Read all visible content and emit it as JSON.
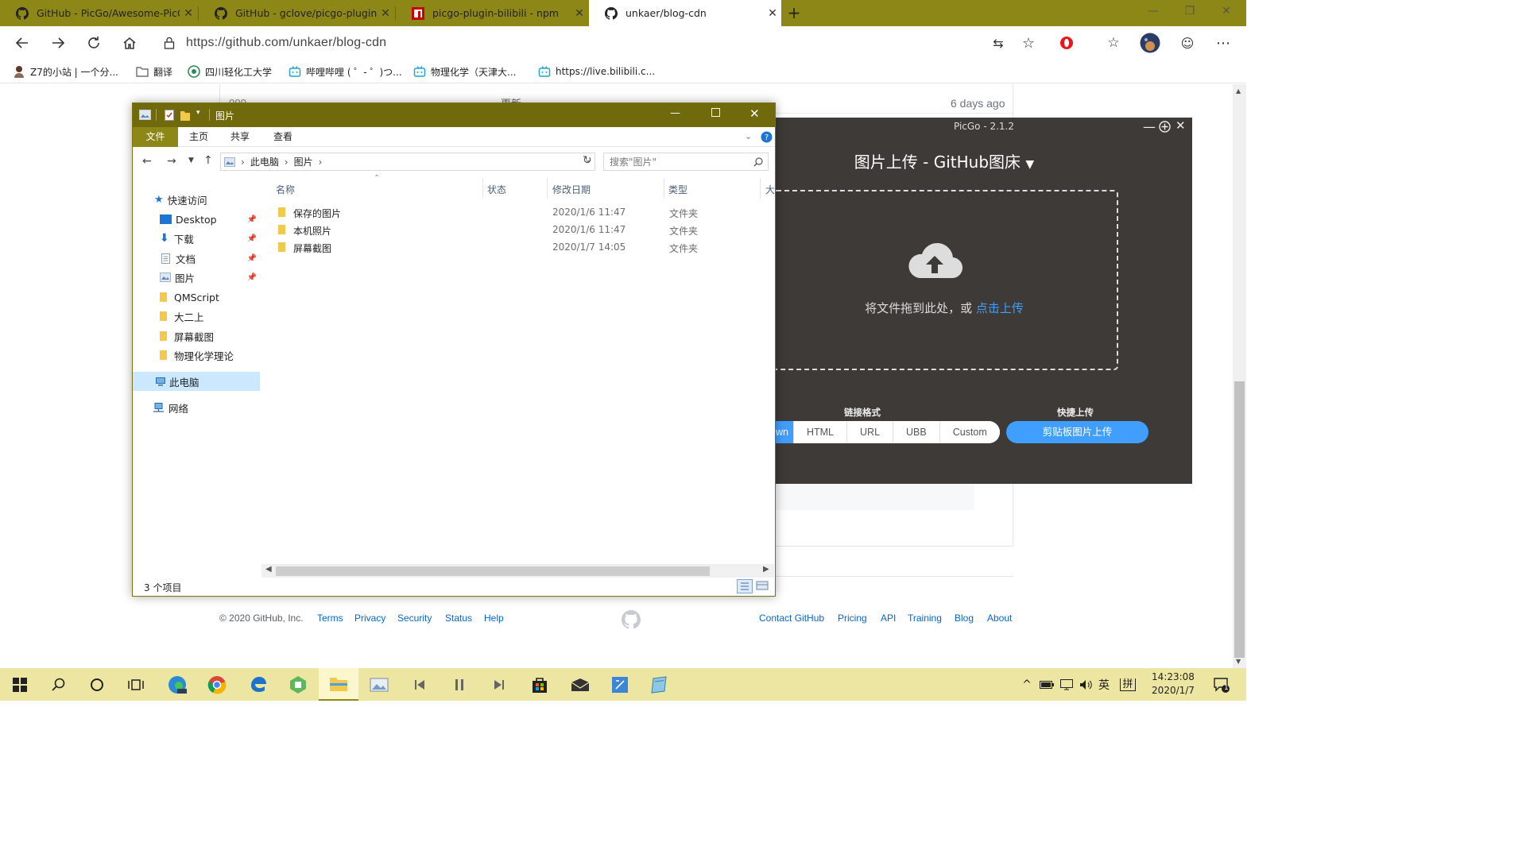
{
  "browser": {
    "tabs": [
      {
        "title": "GitHub - PicGo/Awesome-PicGo",
        "icon": "github-icon"
      },
      {
        "title": "GitHub - gclove/picgo-plugin-su",
        "icon": "github-icon"
      },
      {
        "title": "picgo-plugin-bilibili - npm",
        "icon": "npm-icon"
      },
      {
        "title": "unkaer/blog-cdn",
        "icon": "github-icon"
      }
    ],
    "close_glyph": "✕",
    "new_tab_glyph": "+",
    "url": "https://github.com/unkaer/blog-cdn",
    "favorites": [
      {
        "label": "Z7的小站 | 一个分...",
        "icon": "avatar-icon"
      },
      {
        "label": "翻译",
        "icon": "folder-icon"
      },
      {
        "label": "四川轻化工大学",
        "icon": "globe-icon"
      },
      {
        "label": "哔哩哔哩 ( ゜- ゜)つ...",
        "icon": "bilibili-icon"
      },
      {
        "label": "物理化学（天津大...",
        "icon": "bilibili-icon"
      },
      {
        "label": "https://live.bilibili.c...",
        "icon": "bilibili-icon"
      }
    ]
  },
  "github": {
    "row_time": "6 days ago",
    "row_partial_a": "ooo",
    "row_partial_b": "更新",
    "copyright": "© 2020 GitHub, Inc.",
    "footer_left": [
      "Terms",
      "Privacy",
      "Security",
      "Status",
      "Help"
    ],
    "footer_right": [
      "Contact GitHub",
      "Pricing",
      "API",
      "Training",
      "Blog",
      "About"
    ]
  },
  "picgo": {
    "window_title": "PicGo - 2.1.2",
    "heading": "图片上传 - GitHub图床",
    "drop_text": "将文件拖到此处，或 ",
    "drop_link": "点击上传",
    "link_format_label": "链接格式",
    "quick_upload_label": "快捷上传",
    "formats": [
      "wn",
      "HTML",
      "URL",
      "UBB",
      "Custom"
    ],
    "paste_button": "剪贴板图片上传",
    "accent": "#409eff"
  },
  "explorer": {
    "title": "图片",
    "ribbon_tabs": [
      "文件",
      "主页",
      "共享",
      "查看"
    ],
    "breadcrumb": [
      "此电脑",
      "图片"
    ],
    "search_placeholder": "搜索\"图片\"",
    "sidebar": [
      {
        "label": "快速访问",
        "icon": "star-icon",
        "indent": 0
      },
      {
        "label": "Desktop",
        "icon": "desktop-icon",
        "indent": 1,
        "pinned": true
      },
      {
        "label": "下载",
        "icon": "download-icon",
        "indent": 1,
        "pinned": true
      },
      {
        "label": "文档",
        "icon": "document-icon",
        "indent": 1,
        "pinned": true
      },
      {
        "label": "图片",
        "icon": "pictures-icon",
        "indent": 1,
        "pinned": true
      },
      {
        "label": "QMScript",
        "icon": "folder-icon",
        "indent": 1
      },
      {
        "label": "大二上",
        "icon": "folder-icon",
        "indent": 1
      },
      {
        "label": "屏幕截图",
        "icon": "folder-icon",
        "indent": 1
      },
      {
        "label": "物理化学理论",
        "icon": "folder-icon",
        "indent": 1
      },
      {
        "label": "此电脑",
        "icon": "computer-icon",
        "indent": 0,
        "selected": true
      },
      {
        "label": "网络",
        "icon": "network-icon",
        "indent": 0
      }
    ],
    "columns": [
      "名称",
      "状态",
      "修改日期",
      "类型",
      "大"
    ],
    "files": [
      {
        "name": "保存的图片",
        "date": "2020/1/6 11:47",
        "type": "文件夹"
      },
      {
        "name": "本机照片",
        "date": "2020/1/6 11:47",
        "type": "文件夹"
      },
      {
        "name": "屏幕截图",
        "date": "2020/1/7 14:05",
        "type": "文件夹"
      }
    ],
    "status": "3 个项目"
  },
  "taskbar": {
    "time": "14:23:08",
    "date": "2020/1/7",
    "ime_lang": "英",
    "ime_mode": "拼",
    "notification_count": "1",
    "colors": {
      "bar": "#ede6a3",
      "accent": "#8d8718"
    }
  }
}
